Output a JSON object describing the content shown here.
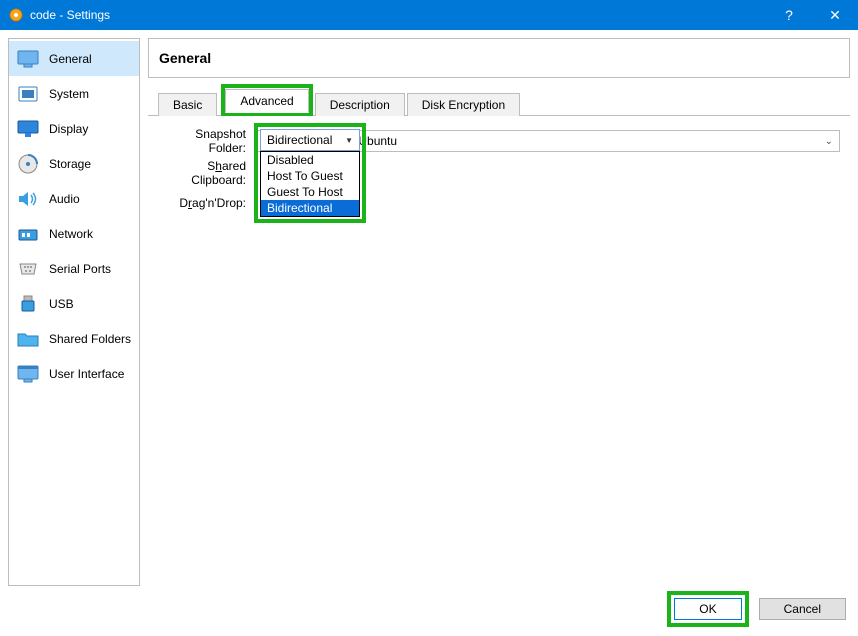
{
  "titlebar": {
    "title": "code - Settings",
    "help": "?",
    "close": "✕"
  },
  "sidebar": {
    "items": [
      {
        "label": "General"
      },
      {
        "label": "System"
      },
      {
        "label": "Display"
      },
      {
        "label": "Storage"
      },
      {
        "label": "Audio"
      },
      {
        "label": "Network"
      },
      {
        "label": "Serial Ports"
      },
      {
        "label": "USB"
      },
      {
        "label": "Shared Folders"
      },
      {
        "label": "User Interface"
      }
    ]
  },
  "header": {
    "title": "General"
  },
  "tabs": {
    "items": [
      {
        "label": "Basic"
      },
      {
        "label": "Advanced"
      },
      {
        "label": "Description"
      },
      {
        "label": "Disk Encryption"
      }
    ]
  },
  "form": {
    "snapshot_label": "Snapshot Folder:",
    "snapshot_value": "C:\\Codetryout\\Ubuntu",
    "clipboard_label_pre": "S",
    "clipboard_label_ul": "h",
    "clipboard_label_post": "ared Clipboard:",
    "clipboard_value": "Bidirectional",
    "dragdrop_label_pre": "D",
    "dragdrop_label_ul": "r",
    "dragdrop_label_post": "ag'n'Drop:",
    "dropdown_options": [
      "Disabled",
      "Host To Guest",
      "Guest To Host",
      "Bidirectional"
    ]
  },
  "footer": {
    "ok": "OK",
    "cancel": "Cancel"
  }
}
